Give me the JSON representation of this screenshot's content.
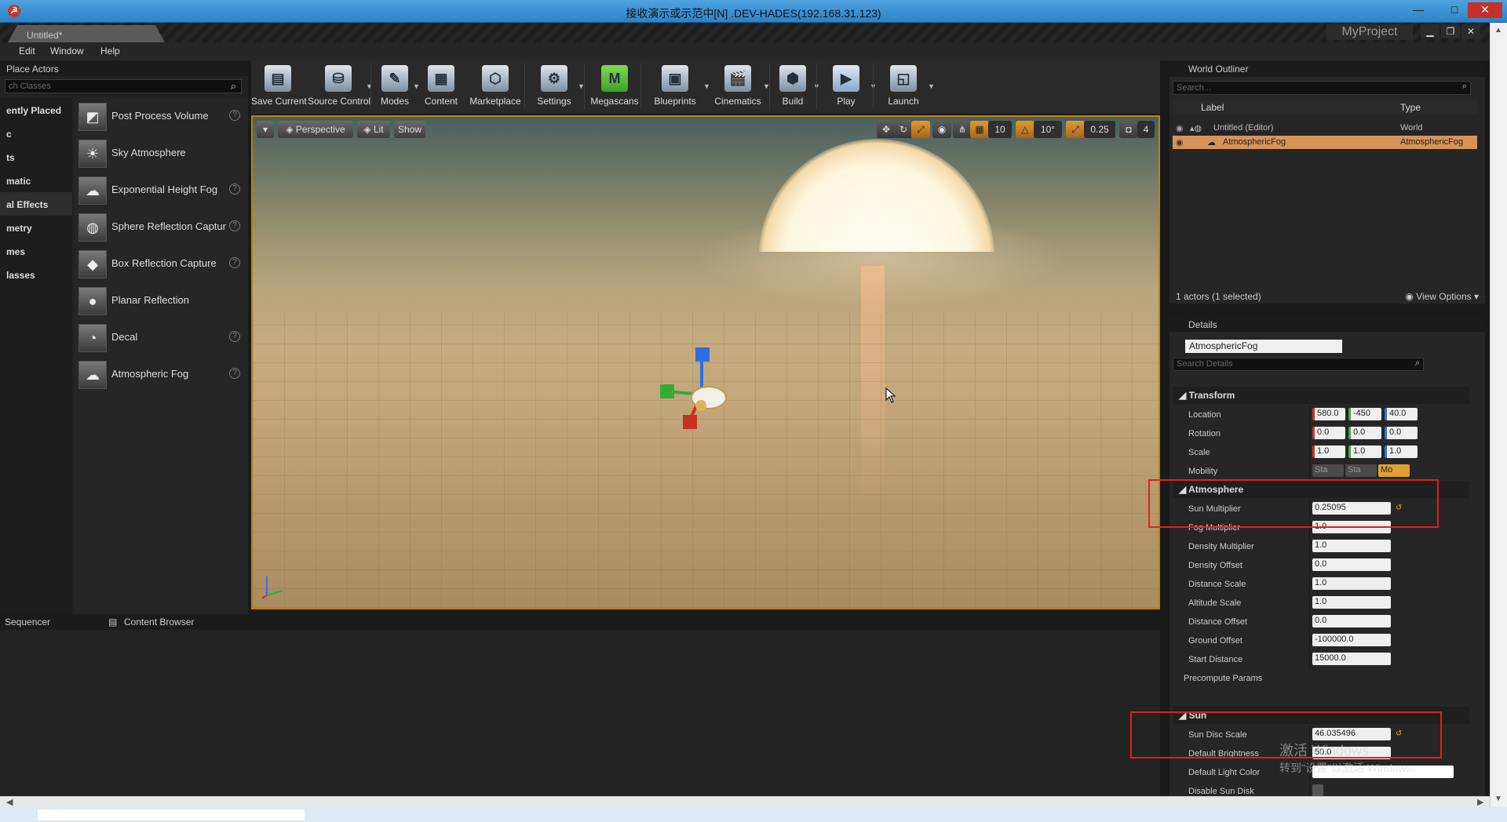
{
  "rdp": {
    "title": "接收演示或示范中[N] .DEV-HADES(192.168.31.123)",
    "logo": "☭",
    "min": "—",
    "max": "□",
    "close": "✕"
  },
  "editor": {
    "tab": "Untitled*",
    "project": "MyProject"
  },
  "menu": [
    "Edit",
    "Window",
    "Help"
  ],
  "place_actors": {
    "tab": "Place Actors",
    "search_placeholder": "ch Classes",
    "categories": [
      "ently Placed",
      "c",
      "ts",
      "matic",
      "al Effects",
      "metry",
      "mes",
      "lasses"
    ],
    "selected_category": 4,
    "items": [
      {
        "label": "Post Process Volume",
        "icon": "post-process-icon",
        "glyph": "◩",
        "help": true
      },
      {
        "label": "Sky Atmosphere",
        "icon": "sky-atmosphere-icon",
        "glyph": "☀",
        "help": false
      },
      {
        "label": "Exponential Height Fog",
        "icon": "height-fog-icon",
        "glyph": "☁",
        "help": true
      },
      {
        "label": "Sphere Reflection Captur",
        "icon": "sphere-reflection-icon",
        "glyph": "◍",
        "help": true
      },
      {
        "label": "Box Reflection Capture",
        "icon": "box-reflection-icon",
        "glyph": "◆",
        "help": true
      },
      {
        "label": "Planar Reflection",
        "icon": "planar-reflection-icon",
        "glyph": "●",
        "help": false
      },
      {
        "label": "Decal",
        "icon": "decal-icon",
        "glyph": "◔",
        "help": true
      },
      {
        "label": "Atmospheric Fog",
        "icon": "atmospheric-fog-icon",
        "glyph": "☁",
        "help": true
      }
    ]
  },
  "toolbar": [
    {
      "label": "Save Current",
      "icon": "save-icon",
      "glyph": "▤"
    },
    {
      "label": "Source Control",
      "icon": "source-control-icon",
      "glyph": "⛁"
    },
    {
      "label": "Modes",
      "icon": "modes-icon",
      "glyph": "✎"
    },
    {
      "label": "Content",
      "icon": "content-icon",
      "glyph": "▦"
    },
    {
      "label": "Marketplace",
      "icon": "marketplace-icon",
      "glyph": "⬡"
    },
    {
      "label": "Settings",
      "icon": "settings-icon",
      "glyph": "⚙"
    },
    {
      "label": "Megascans",
      "icon": "megascans-icon",
      "glyph": "M"
    },
    {
      "label": "Blueprints",
      "icon": "blueprints-icon",
      "glyph": "▣"
    },
    {
      "label": "Cinematics",
      "icon": "cinematics-icon",
      "glyph": "🎬"
    },
    {
      "label": "Build",
      "icon": "build-icon",
      "glyph": "⬢"
    },
    {
      "label": "Play",
      "icon": "play-icon",
      "glyph": "▶"
    },
    {
      "label": "Launch",
      "icon": "launch-icon",
      "glyph": "◱"
    }
  ],
  "viewport": {
    "perspective": "Perspective",
    "lit": "Lit",
    "show": "Show",
    "grid_snap": "10",
    "rot_snap": "10°",
    "scale_snap": "0.25",
    "cam_speed": "4"
  },
  "bottom_tabs": [
    "Sequencer",
    "Content Browser"
  ],
  "outliner": {
    "tab": "World Outliner",
    "search_placeholder": "Search...",
    "col_label": "Label",
    "col_type": "Type",
    "rows": [
      {
        "label": "Untitled (Editor)",
        "type": "World",
        "selected": false
      },
      {
        "label": "AtmosphericFog",
        "type": "AtmosphericFog",
        "selected": true
      }
    ],
    "footer": "1 actors (1 selected)",
    "view_options": "View Options"
  },
  "details": {
    "tab": "Details",
    "actor_name": "AtmosphericFog",
    "search_placeholder": "Search Details",
    "transform": {
      "title": "Transform",
      "location_label": "Location",
      "location": [
        "580.0",
        "-450",
        "40.0"
      ],
      "rotation_label": "Rotation",
      "rotation": [
        "0.0",
        "0.0",
        "0.0"
      ],
      "scale_label": "Scale",
      "scale": [
        "1.0",
        "1.0",
        "1.0"
      ],
      "mobility_label": "Mobility",
      "mobility": [
        "Sta",
        "Sta",
        "Mo"
      ]
    },
    "atmosphere": {
      "title": "Atmosphere",
      "props": [
        {
          "label": "Sun Multiplier",
          "value": "0.25095",
          "reset": true
        },
        {
          "label": "Fog Multiplier",
          "value": "1.0",
          "reset": false
        },
        {
          "label": "Density Multiplier",
          "value": "1.0",
          "reset": false
        },
        {
          "label": "Density Offset",
          "value": "0.0",
          "reset": false
        },
        {
          "label": "Distance Scale",
          "value": "1.0",
          "reset": false
        },
        {
          "label": "Altitude Scale",
          "value": "1.0",
          "reset": false
        },
        {
          "label": "Distance Offset",
          "value": "0.0",
          "reset": false
        },
        {
          "label": "Ground Offset",
          "value": "-100000.0",
          "reset": false
        },
        {
          "label": "Start Distance",
          "value": "15000.0",
          "reset": false
        }
      ],
      "precompute": "Precompute Params"
    },
    "sun": {
      "title": "Sun",
      "props": [
        {
          "label": "Sun Disc Scale",
          "value": "46.035496",
          "reset": true
        },
        {
          "label": "Default Brightness",
          "value": "50.0",
          "reset": false
        }
      ],
      "light_color": "Default Light Color",
      "disable_disk": "Disable Sun Disk"
    }
  },
  "watermark": {
    "line1": "激活 Windows",
    "line2": "转到\"设置\"以激活 Windows。"
  },
  "colors": {
    "selection": "#d8935a",
    "highlight_box": "#e02020",
    "viewport_border": "#b8860b"
  }
}
